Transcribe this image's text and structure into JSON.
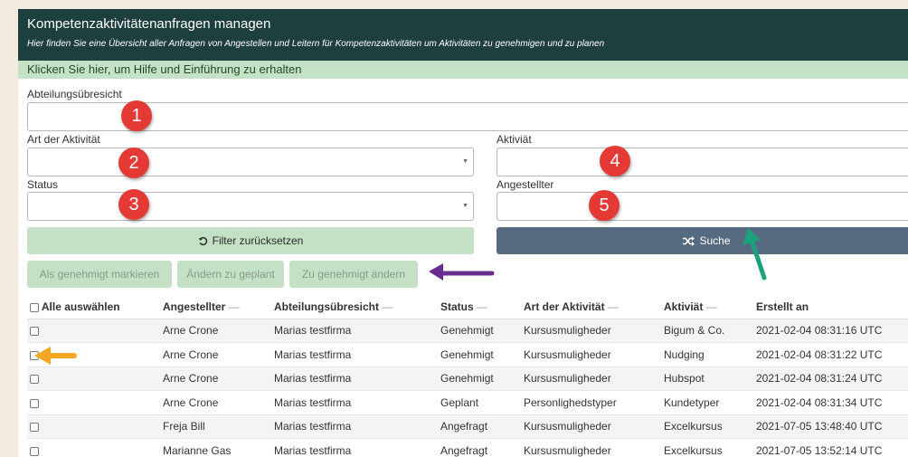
{
  "header": {
    "title": "Kompetenzaktivitätenanfragen managen",
    "subtitle": "Hier finden Sie eine Übersicht aller Anfragen von Angestellen und Leitern für Kompetenzaktivitäten um Aktivitäten zu genehmigen und zu planen"
  },
  "help_text": "Klicken Sie hier, um Hilfe und Einführung zu erhalten",
  "filters": {
    "abteilung_label": "Abteilungsübresicht",
    "art_label": "Art der Aktivität",
    "aktivitaet_label": "Aktiviät",
    "status_label": "Status",
    "angestellter_label": "Angestellter"
  },
  "buttons": {
    "reset": "Filter zurücksetzen",
    "search": "Suche",
    "mark_approved": "Als genehmigt markieren",
    "change_planned": "Ändern zu geplant",
    "change_approved": "Zu genehmigt ändern"
  },
  "markers": [
    "1",
    "2",
    "3",
    "4",
    "5"
  ],
  "table": {
    "select_all": "Alle auswählen",
    "sort_glyph": "—",
    "columns": [
      "Angestellter",
      "Abteilungsübresicht",
      "Status",
      "Art der Aktivität",
      "Aktiviät",
      "Erstellt an"
    ],
    "rows": [
      [
        "Arne Crone",
        "Marias testfirma",
        "Genehmigt",
        "Kursusmuligheder",
        "Bigum & Co.",
        "2021-02-04 08:31:16 UTC"
      ],
      [
        "Arne Crone",
        "Marias testfirma",
        "Genehmigt",
        "Kursusmuligheder",
        "Nudging",
        "2021-02-04 08:31:22 UTC"
      ],
      [
        "Arne Crone",
        "Marias testfirma",
        "Genehmigt",
        "Kursusmuligheder",
        "Hubspot",
        "2021-02-04 08:31:24 UTC"
      ],
      [
        "Arne Crone",
        "Marias testfirma",
        "Geplant",
        "Personlighedstyper",
        "Kundetyper",
        "2021-02-04 08:31:34 UTC"
      ],
      [
        "Freja Bill",
        "Marias testfirma",
        "Angefragt",
        "Kursusmuligheder",
        "Excelkursus",
        "2021-07-05 13:48:40 UTC"
      ],
      [
        "Marianne Gas",
        "Marias testfirma",
        "Angefragt",
        "Kursusmuligheder",
        "Excelkursus",
        "2021-07-05 13:52:14 UTC"
      ]
    ]
  },
  "colors": {
    "header_bg": "#1d3f3d",
    "help_bg": "#c5e2c6",
    "search_bg": "#566b80",
    "marker": "#e53935",
    "arrow_purple": "#6a2c91",
    "arrow_orange": "#f5a623",
    "arrow_teal": "#1aa37a"
  }
}
